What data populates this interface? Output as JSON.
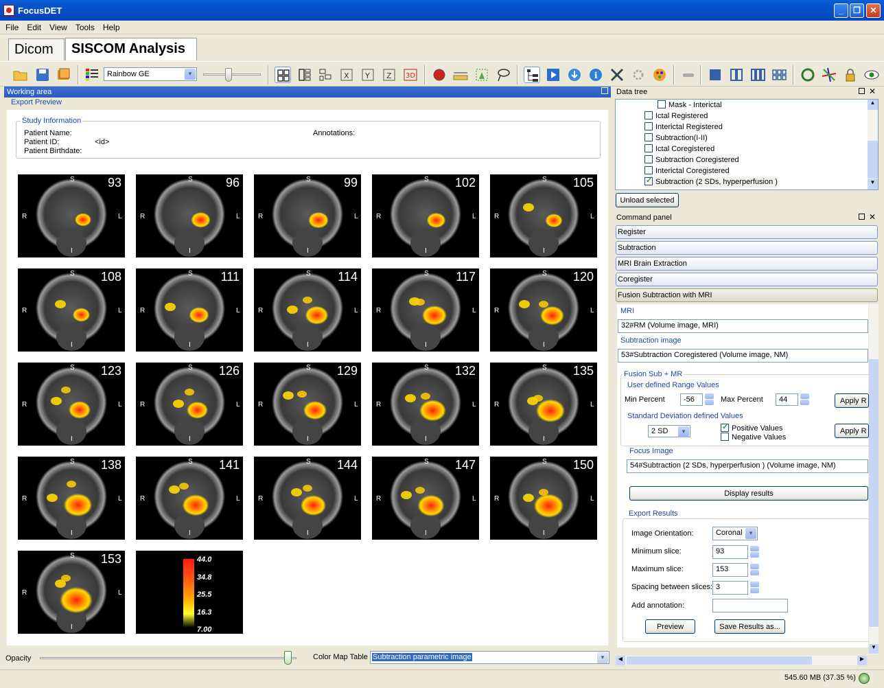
{
  "window": {
    "title": "FocusDET"
  },
  "menu": [
    "File",
    "Edit",
    "View",
    "Tools",
    "Help"
  ],
  "tabs": [
    {
      "label": "Dicom"
    },
    {
      "label": "SISCOM Analysis"
    }
  ],
  "toolbar": {
    "colormap_value": "Rainbow GE",
    "colormap_options": [
      "Rainbow GE"
    ],
    "slider_fraction": 0.4
  },
  "working_area": {
    "title": "Working area",
    "subtitle": "Export Preview",
    "study_info": {
      "legend": "Study Information",
      "patient_name_label": "Patient Name:",
      "patient_id_label": "Patient ID:",
      "patient_id_value": "<id>",
      "patient_birthdate_label": "Patient Birthdate:",
      "annotations_label": "Annotations:"
    },
    "orientation_labels": {
      "top": "S",
      "left": "R",
      "right": "L",
      "bottom": "I"
    },
    "slices": [
      93,
      96,
      99,
      102,
      105,
      108,
      111,
      114,
      117,
      120,
      123,
      126,
      129,
      132,
      135,
      138,
      141,
      144,
      147,
      150,
      153
    ],
    "colorbar": {
      "max": "44.0",
      "t1": "34.8",
      "t2": "25.5",
      "t3": "16.3",
      "min": "7.00"
    }
  },
  "bottom": {
    "opacity_label": "Opacity",
    "opacity_fraction": 0.98,
    "colormap_table_label": "Color Map Table",
    "colormap_table_value": "Subtraction parametric image"
  },
  "data_tree": {
    "title": "Data tree",
    "items": [
      {
        "label": "Mask - Interictal",
        "checked": false,
        "indent": 1
      },
      {
        "label": "Ictal Registered",
        "checked": false,
        "indent": 0
      },
      {
        "label": "Interictal Registered",
        "checked": false,
        "indent": 0
      },
      {
        "label": "Subtraction(I-II)",
        "checked": false,
        "indent": 0
      },
      {
        "label": "Ictal Coregistered",
        "checked": false,
        "indent": 0
      },
      {
        "label": "Subtraction Coregistered",
        "checked": false,
        "indent": 0
      },
      {
        "label": "Interictal Coregistered",
        "checked": false,
        "indent": 0
      },
      {
        "label": "Subtraction (2 SDs, hyperperfusion )",
        "checked": true,
        "indent": 0
      }
    ],
    "unload_button": "Unload selected"
  },
  "command_panel": {
    "title": "Command panel",
    "sections": [
      "Register",
      "Subtraction",
      "MRI Brain Extraction",
      "Coregister",
      "Fusion Subtraction with MRI"
    ],
    "mri_label": "MRI",
    "mri_value": "32#RM (Volume image, MRI)",
    "subtraction_label": "Subtraction image",
    "subtraction_value": "53#Subtraction Coregistered (Volume image, NM)",
    "fusion_label": "Fusion Sub + MR",
    "user_range_label": "User defined Range Values",
    "min_percent_label": "Min Percent",
    "min_percent_value": "-56",
    "max_percent_label": "Max Percent",
    "max_percent_value": "44",
    "apply_label": "Apply R",
    "std_label": "Standard Deviation defined Values",
    "sd_value": "2 SD",
    "positive_label": "Positive Values",
    "positive_checked": true,
    "negative_label": "Negative Values",
    "negative_checked": false,
    "apply2_label": "Apply R",
    "focus_label": "Focus Image",
    "focus_value": "54#Subtraction (2 SDs, hyperperfusion ) (Volume image, NM)",
    "display_button": "Display results",
    "export_label": "Export Results",
    "orientation_label": "Image Orientation:",
    "orientation_value": "Coronal",
    "min_slice_label": "Minimum slice:",
    "min_slice_value": "93",
    "max_slice_label": "Maximum slice:",
    "max_slice_value": "153",
    "spacing_label": "Spacing between slices:",
    "spacing_value": "3",
    "annotation_label": "Add annotation:",
    "annotation_value": "",
    "preview_button": "Preview",
    "save_button": "Save Results as..."
  },
  "status": {
    "memory": "545.60 MB (37.35 %)"
  },
  "colors": {
    "title_blue": "#0450c9",
    "panel_header": "#3a6fd0",
    "accent_text": "#2246a8"
  }
}
